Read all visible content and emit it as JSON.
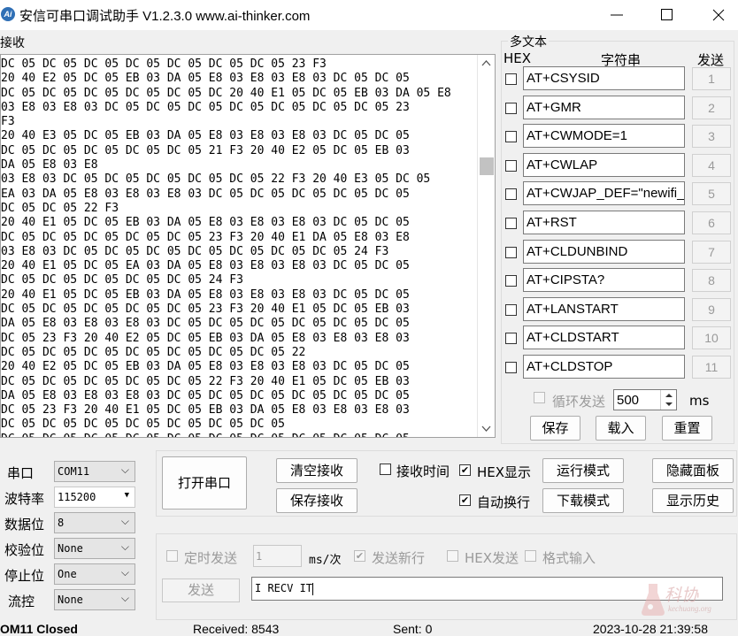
{
  "window": {
    "title": "安信可串口调试助手 V1.2.3.0    www.ai-thinker.com",
    "icon_text": "Ai",
    "minimize_icon": "minimize-icon",
    "maximize_icon": "maximize-icon",
    "close_icon": "close-icon"
  },
  "receive": {
    "label": "接收",
    "lines": [
      "DC 05 DC 05 DC 05 DC 05 DC 05 DC 05 DC 05 23 F3",
      "20 40 E2 05 DC 05 EB 03 DA 05 E8 03 E8 03 E8 03 DC 05 DC 05",
      "DC 05 DC 05 DC 05 DC 05 DC 05 DC 20 40 E1 05 DC 05 EB 03 DA 05 E8",
      "03 E8 03 E8 03 DC 05 DC 05 DC 05 DC 05 DC 05 DC 05 DC 05 23",
      "F3",
      "20 40 E3 05 DC 05 EB 03 DA 05 E8 03 E8 03 E8 03 DC 05 DC 05",
      "DC 05 DC 05 DC 05 DC 05 DC 05 21 F3 20 40 E2 05 DC 05 EB 03",
      "DA 05 E8 03 E8",
      "03 E8 03 DC 05 DC 05 DC 05 DC 05 DC 05 22 F3 20 40 E3 05 DC 05",
      "EA 03 DA 05 E8 03 E8 03 E8 03 DC 05 DC 05 DC 05 DC 05 DC 05",
      "DC 05 DC 05 22 F3",
      "20 40 E1 05 DC 05 EB 03 DA 05 E8 03 E8 03 E8 03 DC 05 DC 05",
      "DC 05 DC 05 DC 05 DC 05 DC 05 23 F3 20 40 E1 DA 05 E8 03 E8",
      "03 E8 03 DC 05 DC 05 DC 05 DC 05 DC 05 DC 05 DC 05 24 F3",
      "20 40 E1 05 DC 05 EA 03 DA 05 E8 03 E8 03 E8 03 DC 05 DC 05",
      "DC 05 DC 05 DC 05 DC 05 DC 05 24 F3",
      "20 40 E1 05 DC 05 EB 03 DA 05 E8 03 E8 03 E8 03 DC 05 DC 05",
      "DC 05 DC 05 DC 05 DC 05 DC 05 23 F3 20 40 E1 05 DC 05 EB 03",
      "DA 05 E8 03 E8 03 E8 03 DC 05 DC 05 DC 05 DC 05 DC 05 DC 05",
      "DC 05 23 F3 20 40 E2 05 DC 05 EB 03 DA 05 E8 03 E8 03 E8 03",
      "DC 05 DC 05 DC 05 DC 05 DC 05 DC 05 DC 05 22",
      "20 40 E2 05 DC 05 EB 03 DA 05 E8 03 E8 03 E8 03 DC 05 DC 05",
      "DC 05 DC 05 DC 05 DC 05 DC 05 22 F3 20 40 E1 05 DC 05 EB 03",
      "DA 05 E8 03 E8 03 E8 03 DC 05 DC 05 DC 05 DC 05 DC 05 DC 05",
      "DC 05 23 F3 20 40 E1 05 DC 05 EB 03 DA 05 E8 03 E8 03 E8 03",
      "DC 05 DC 05 DC 05 DC 05 DC 05 DC 05 DC 05",
      "DC 05 DC 05 DC 05 DC 05 DC 05 DC 05 DC 05 DC 05 DC 05 DC 05"
    ]
  },
  "multi": {
    "title": "多文本",
    "hex_header": "HEX",
    "string_header": "字符串",
    "send_header": "发送",
    "rows": [
      {
        "text": "AT+CSYSID",
        "btn": "1"
      },
      {
        "text": "AT+GMR",
        "btn": "2"
      },
      {
        "text": "AT+CWMODE=1",
        "btn": "3"
      },
      {
        "text": "AT+CWLAP",
        "btn": "4"
      },
      {
        "text": "AT+CWJAP_DEF=\"newifi_",
        "btn": "5"
      },
      {
        "text": "AT+RST",
        "btn": "6"
      },
      {
        "text": "AT+CLDUNBIND",
        "btn": "7"
      },
      {
        "text": "AT+CIPSTA?",
        "btn": "8"
      },
      {
        "text": "AT+LANSTART",
        "btn": "9"
      },
      {
        "text": "AT+CLDSTART",
        "btn": "10"
      },
      {
        "text": "AT+CLDSTOP",
        "btn": "11"
      }
    ],
    "loop_label": "循环发送",
    "loop_value": "500",
    "loop_unit": "ms",
    "save": "保存",
    "load": "载入",
    "reset": "重置"
  },
  "settings": {
    "port_label": "串口",
    "port_value": "COM11",
    "baud_label": "波特率",
    "baud_value": "115200",
    "data_label": "数据位",
    "data_value": "8",
    "parity_label": "校验位",
    "parity_value": "None",
    "stop_label": "停止位",
    "stop_value": "One",
    "flow_label": "流控",
    "flow_value": "None"
  },
  "controls": {
    "open_port": "打开串口",
    "clear_recv": "清空接收",
    "save_recv": "保存接收",
    "recv_time": "接收时间",
    "hex_display": "HEX显示",
    "auto_wrap": "自动换行",
    "run_mode": "运行模式",
    "download_mode": "下载模式",
    "hide_panel": "隐藏面板",
    "show_history": "显示历史"
  },
  "send": {
    "timed_send": "定时发送",
    "interval_value": "1",
    "interval_unit": "ms/次",
    "send_newline": "发送新行",
    "hex_send": "HEX发送",
    "format_input": "格式输入",
    "send_button": "发送",
    "send_text": "I RECV IT"
  },
  "status": {
    "port": "OM11 Closed",
    "received": "Received: 8543",
    "sent": "Sent: 0",
    "time": "2023-10-28 21:39:58"
  },
  "watermark": {
    "text_cn": "科协",
    "text_en": "kechuang.org"
  },
  "colors": {
    "accent_icon": "#2f6fb5",
    "disabled_text": "#9a9a9a",
    "watermark": "#e6b0b0"
  }
}
